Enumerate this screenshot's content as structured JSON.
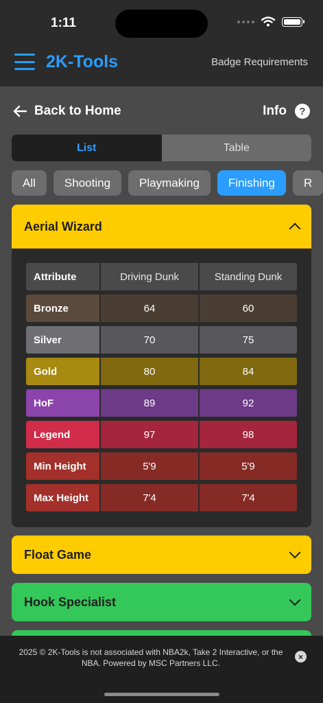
{
  "status": {
    "time": "1:11"
  },
  "header": {
    "brand": "2K-Tools",
    "nav_link": "Badge Requirements"
  },
  "subheader": {
    "back_label": "Back to Home",
    "info_label": "Info",
    "info_icon": "?"
  },
  "view_toggle": {
    "list": "List",
    "table": "Table",
    "selected": "List"
  },
  "categories": {
    "all": "All",
    "shooting": "Shooting",
    "playmaking": "Playmaking",
    "finishing": "Finishing",
    "partial": "R",
    "selected": "Finishing"
  },
  "badges": {
    "aerial_wizard": {
      "name": "Aerial Wizard",
      "expanded": true,
      "header": {
        "attribute": "Attribute",
        "col1": "Driving Dunk",
        "col2": "Standing Dunk"
      },
      "rows": [
        {
          "label": "Bronze",
          "v1": "64",
          "v2": "60",
          "label_bg": "#5b4a3c",
          "val_bg": "#4a3e33"
        },
        {
          "label": "Silver",
          "v1": "70",
          "v2": "75",
          "label_bg": "#6e6e73",
          "val_bg": "#58585c"
        },
        {
          "label": "Gold",
          "v1": "80",
          "v2": "84",
          "label_bg": "#a88a12",
          "val_bg": "#80690f"
        },
        {
          "label": "HoF",
          "v1": "89",
          "v2": "92",
          "label_bg": "#8b44ab",
          "val_bg": "#6c3a86"
        },
        {
          "label": "Legend",
          "v1": "97",
          "v2": "98",
          "label_bg": "#d12c4a",
          "val_bg": "#a5253d"
        },
        {
          "label": "Min Height",
          "v1": "5'9",
          "v2": "5'9",
          "label_bg": "#a3302a",
          "val_bg": "#862a26"
        },
        {
          "label": "Max Height",
          "v1": "7'4",
          "v2": "7'4",
          "label_bg": "#a3302a",
          "val_bg": "#862a26"
        }
      ]
    },
    "float_game": {
      "name": "Float Game",
      "expanded": false,
      "color": "#ffcc00"
    },
    "hook_specialist": {
      "name": "Hook Specialist",
      "expanded": false,
      "color": "#34c759"
    }
  },
  "footer": {
    "text": "2025 © 2K-Tools is not associated with NBA2k, Take 2 Interactive, or the NBA. Powered by MSC Partners LLC.",
    "close_icon": "×"
  }
}
